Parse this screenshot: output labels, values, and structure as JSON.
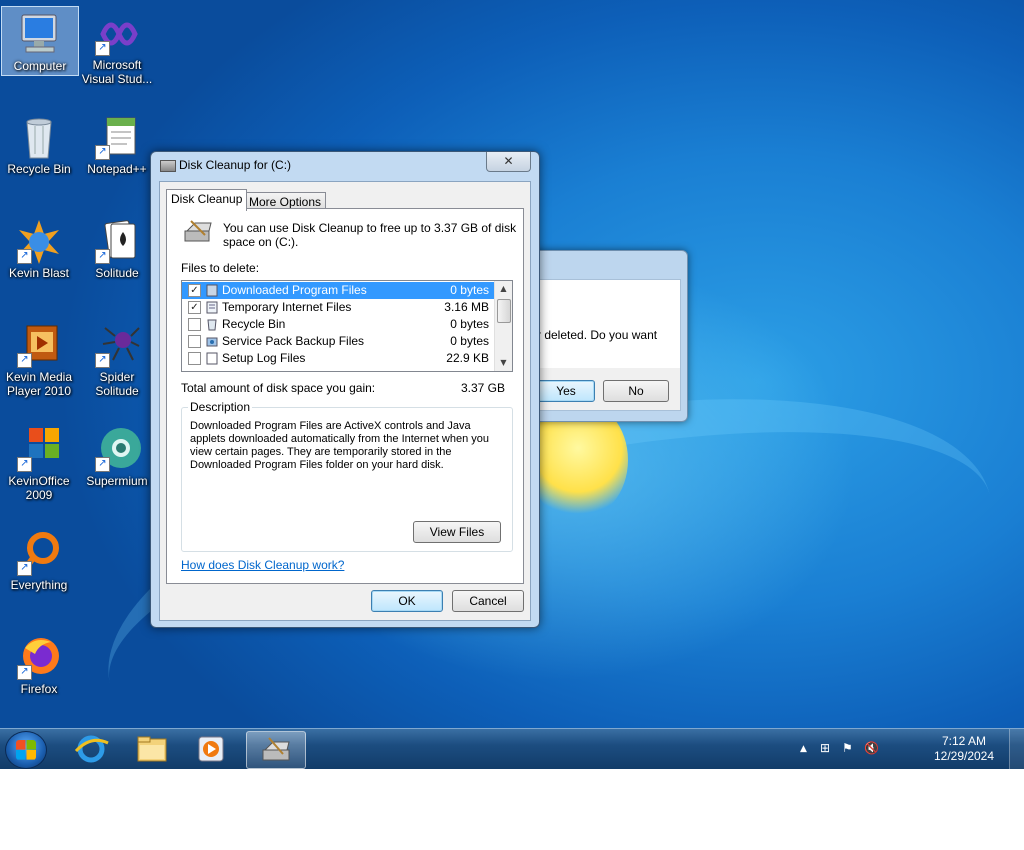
{
  "desktop": {
    "icons": [
      {
        "label": "Computer",
        "icon": "computer-icon"
      },
      {
        "label": "Microsoft Visual Stud...",
        "icon": "visual-studio-icon"
      },
      {
        "label": "Recycle Bin",
        "icon": "recycle-bin-icon"
      },
      {
        "label": "Notepad++",
        "icon": "notepadpp-icon"
      },
      {
        "label": "Kevin Blast",
        "icon": "kevin-blast-icon"
      },
      {
        "label": "Solitude",
        "icon": "solitude-icon"
      },
      {
        "label": "Kevin Media Player 2010",
        "icon": "media-player-icon"
      },
      {
        "label": "Spider Solitude",
        "icon": "spider-solitude-icon"
      },
      {
        "label": "KevinOffice 2009",
        "icon": "office-icon"
      },
      {
        "label": "Supermium",
        "icon": "supermium-icon"
      },
      {
        "label": "Everything",
        "icon": "everything-icon"
      },
      {
        "label": "Firefox",
        "icon": "firefox-icon"
      }
    ]
  },
  "back_dialog": {
    "message": "r deleted. Do you want",
    "yes_label": "Yes",
    "no_label": "No"
  },
  "dialog": {
    "title": "Disk Cleanup for  (C:)",
    "close_glyph": "✕",
    "tabs": [
      {
        "label": "Disk Cleanup",
        "active": true
      },
      {
        "label": "More Options",
        "active": false
      }
    ],
    "intro_line1": "You can use Disk Cleanup to free up to 3.37 GB of disk",
    "intro_line2": "space on  (C:).",
    "files_label": "Files to delete:",
    "files": [
      {
        "name": "Downloaded Program Files",
        "size": "0 bytes",
        "checked": true,
        "selected": true
      },
      {
        "name": "Temporary Internet Files",
        "size": "3.16 MB",
        "checked": true,
        "selected": false
      },
      {
        "name": "Recycle Bin",
        "size": "0 bytes",
        "checked": false,
        "selected": false
      },
      {
        "name": "Service Pack Backup Files",
        "size": "0 bytes",
        "checked": false,
        "selected": false
      },
      {
        "name": "Setup Log Files",
        "size": "22.9 KB",
        "checked": false,
        "selected": false
      }
    ],
    "total_label": "Total amount of disk space you gain:",
    "total_value": "3.37 GB",
    "description_label": "Description",
    "description_text": "Downloaded Program Files are ActiveX controls and Java applets downloaded automatically from the Internet when you view certain pages. They are temporarily stored in the Downloaded Program Files folder on your hard disk.",
    "view_files_label": "View Files",
    "help_link": "How does Disk Cleanup work?",
    "ok_label": "OK",
    "cancel_label": "Cancel"
  },
  "taskbar": {
    "time": "7:12 AM",
    "date": "12/29/2024"
  }
}
